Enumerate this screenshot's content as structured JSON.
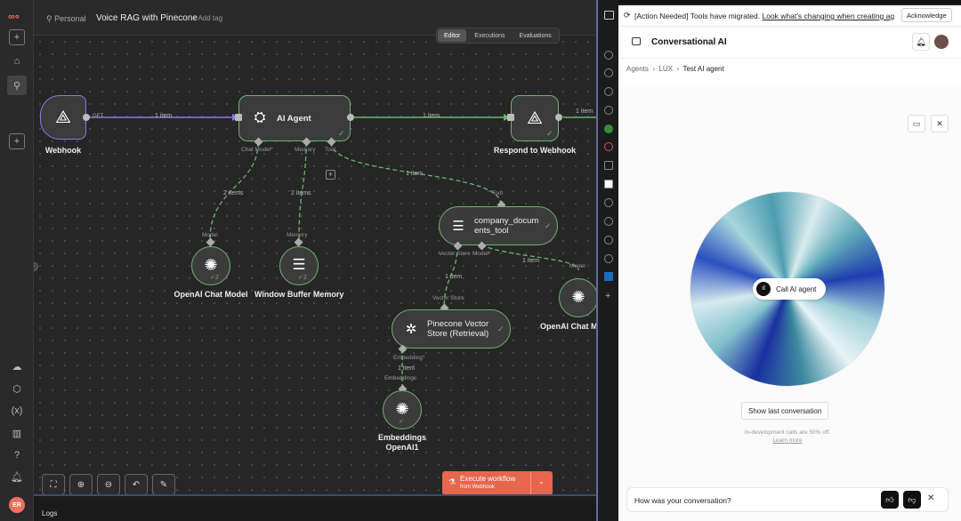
{
  "app": {
    "project": "Personal",
    "workflow_name": "Voice RAG with Pinecone",
    "add_tag": "+ Add tag"
  },
  "tabs": [
    "Editor",
    "Executions",
    "Evaluations"
  ],
  "nodes": {
    "webhook": "Webhook",
    "ai_agent": "AI Agent",
    "respond": "Respond to Webhook",
    "chat_model": "OpenAI Chat Model",
    "memory": "Window Buffer Memory",
    "tool_l1": "company_docum",
    "tool_l2": "ents_tool",
    "pinecone_l1": "Pinecone Vector",
    "pinecone_l2": "Store (Retrieval)",
    "chat_model_2": "OpenAI Chat M",
    "embeddings_l1": "Embeddings",
    "embeddings_l2": "OpenAI1"
  },
  "ports": {
    "get": "GET",
    "chat_model": "Chat Model",
    "memory": "Memory",
    "tool": "Tool",
    "model": "Model",
    "tool_in": "Tool",
    "vector_store": "Vector Store",
    "model_sock": "Model",
    "model_in": "Model",
    "vector_store_in": "Vector Store",
    "embedding": "Embedding",
    "embeddings_in": "Embeddings",
    "required_mark": "*"
  },
  "edges": {
    "e1": "1 item",
    "e2": "1 item",
    "e3": "1 item",
    "e4": "2 items",
    "e5": "2 items",
    "e6": "1 item",
    "e7": "1 item",
    "e8": "1 item",
    "e9": "1 item"
  },
  "badges": {
    "chat_model": "2",
    "memory": "2"
  },
  "execute": {
    "label": "Execute workflow",
    "sub": "from Webhook"
  },
  "logs": "Logs",
  "user_initials": "ER",
  "banner": {
    "text": "[Action Needed] Tools have migrated.",
    "link": "Look what's changing when creating ag",
    "ack": "Acknowledge"
  },
  "panel": {
    "title": "Conversational AI",
    "breadcrumb": [
      "Agents",
      "LUX",
      "Test AI agent"
    ],
    "call_button": "Call AI agent",
    "show_last": "Show last conversation",
    "note": "In-development calls are 50% off.",
    "learn_more": "Learn more",
    "feedback": "How was your conversation?"
  },
  "colors": {
    "accent": "#e6674e",
    "success": "#6fb36f",
    "trigger": "#8a7ae0"
  }
}
